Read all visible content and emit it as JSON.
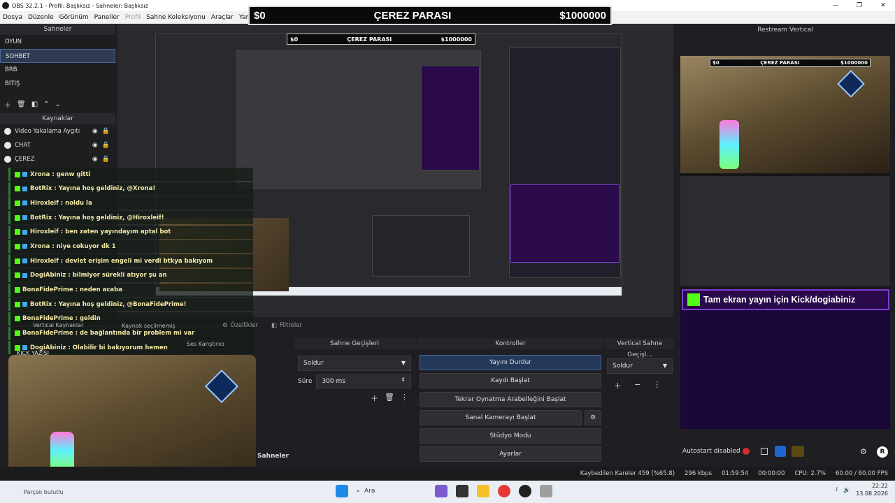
{
  "window": {
    "title": "OBS 32.2.1 - Profil: Başlıksız - Sahneler: Başlıksız",
    "minimize": "—",
    "maximize": "❐",
    "close": "✕"
  },
  "menu": [
    "Dosya",
    "Düzenle",
    "Görünüm",
    "Paneller",
    "Profil",
    "Sahne Koleksiyonu",
    "Araçlar",
    "Yardım"
  ],
  "overlay": {
    "left": "$0",
    "center": "ÇEREZ PARASI",
    "right": "$1000000"
  },
  "scenes": {
    "title": "Sahneler",
    "items": [
      "OYUN",
      "SOHBET",
      "BRB",
      "BITIŞ"
    ],
    "selected": "SOHBET"
  },
  "sources": {
    "title": "Kaynaklar",
    "items": [
      "Video Yakalama Aygıtı",
      "CHAT",
      "ÇEREZ"
    ]
  },
  "chat": [
    "Xrona : genw gitti",
    "BotRix : Yayına hoş geldiniz, @Xrona!",
    "Hiroxleif : noldu la",
    "BotRix : Yayına hoş geldiniz, @Hiroxleif!",
    "Hiroxleif : ben zaten yayındayım aptal bot",
    "Xrona : niye cokuyor dk 1",
    "Hiroxleif : devlet erişim engeli mi verdi btkya bakıyom",
    "DogiAbiniz : bilmiyor sürekli atıyor şu an",
    "BonaFidePrime : neden acaba",
    "BotRix : Yayına hoş geldiniz, @BonaFidePrime!",
    "BonaFidePrime : geldin",
    "BonaFidePrime : de bağlantında bir problem mi var",
    "DogiAbiniz : Olabilir bi bakıyorum hemen"
  ],
  "sidebar_misc": {
    "vertical_sources": "Vertical Kaynaklar",
    "no_source": "Kaynak seçilmemiş",
    "properties": "Özellikler",
    "filters": "Filtreler",
    "mixer": "Ses Karıştırıcı",
    "kick_text": "KICK YAZISI",
    "scenes_button": "Sahneler"
  },
  "vertical": {
    "title": "Restream Vertical",
    "banner": "Tam ekran yayın için Kick/dogiabiniz",
    "autostart": "Autostart disabled",
    "r_button": "R"
  },
  "transitions": {
    "title": "Sahne Geçişleri",
    "selected": "Soldur",
    "duration_label": "Süre",
    "duration_value": "300 ms"
  },
  "controls": {
    "title": "Kontroller",
    "buttons": [
      "Yayını Durdur",
      "Kaydı Başlat",
      "Tekrar Oynatma Arabelleğini Başlat",
      "Sanal Kamerayı Başlat",
      "Stüdyo Modu",
      "Ayarlar"
    ]
  },
  "vertical_transitions": {
    "title": "Vertical Sahne Geçişl...",
    "selected": "Soldur"
  },
  "status": {
    "dropped": "Kaybedilen Kareler 459 (%65.8)",
    "bitrate": "296 kbps",
    "stream_time": "01:59:54",
    "rec_time": "00:00:00",
    "cpu": "CPU: 2.7%",
    "fps": "60.00 / 60.00 FPS"
  },
  "taskbar": {
    "search": "Ara",
    "time": "22:22",
    "date": "13.08.2026",
    "notice": "Parçalı bulutlu"
  },
  "colors": {
    "accent": "#2f3b52",
    "kick": "#53fc18",
    "banner": "#2a0a4a",
    "chat_text": "#f3e8a8"
  }
}
